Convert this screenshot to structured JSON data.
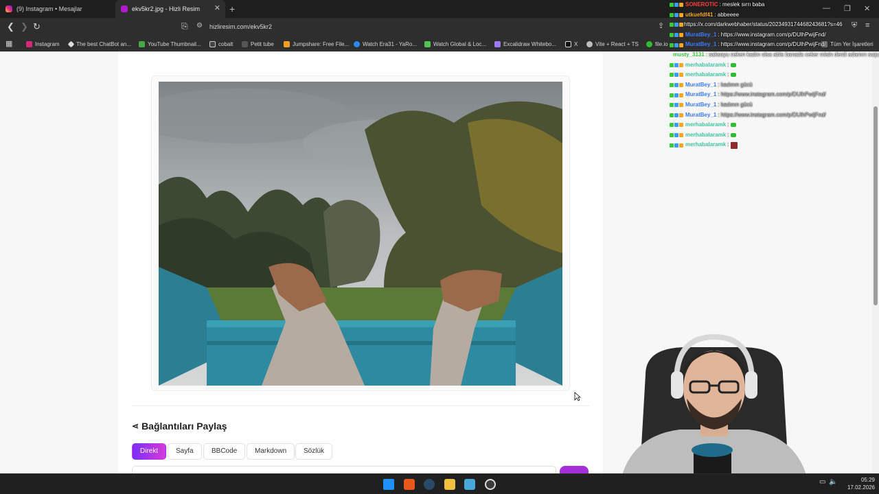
{
  "browser": {
    "tabs": [
      {
        "label": "(9) Instagram • Mesajlar",
        "active": false
      },
      {
        "label": "ekv5kr2.jpg - Hizli Resim",
        "active": true
      }
    ],
    "url": "hizliresim.com/ekv5kr2",
    "bookmarks": [
      {
        "label": "Instagram",
        "color": "#d62976"
      },
      {
        "label": "The best ChatBot an...",
        "color": "#dddddd"
      },
      {
        "label": "YouTube Thumbnail...",
        "color": "#44aa44"
      },
      {
        "label": "cobalt",
        "color": "#cfcfcf"
      },
      {
        "label": "Petit tube",
        "color": "#cfcfcf"
      },
      {
        "label": "Jumpshare: Free File...",
        "color": "#f0a020"
      },
      {
        "label": "Watch Era31 - YaRo...",
        "color": "#2a8cf0"
      },
      {
        "label": "Watch Global & Loc...",
        "color": "#53c453"
      },
      {
        "label": "Excalidraw Whitebo...",
        "color": "#9b7bf0"
      },
      {
        "label": "X",
        "color": "#ffffff"
      },
      {
        "label": "Vite + React + TS",
        "color": "#bdbdbd"
      },
      {
        "label": "file.io",
        "color": "#33bb33"
      }
    ],
    "other_bookmarks": "Tüm Yer İşaretleri"
  },
  "share": {
    "title": "Bağlantıları Paylaş",
    "tabs": [
      "Direkt",
      "Sayfa",
      "BBCode",
      "Markdown",
      "Sözlük"
    ],
    "active_tab": "Direkt"
  },
  "chat": [
    {
      "user": "SONEROTIC",
      "user_color": "#ff3b3b",
      "msg": ": meslek sırrı baba",
      "dim": false
    },
    {
      "user": "utkuefdf41",
      "user_color": "#f5a623",
      "msg": ": abbeeee",
      "dim": false
    },
    {
      "user": "",
      "user_color": "#ffffff",
      "msg": "https://x.com/darkwebhaber/status/2023493174468243681?s=46",
      "dim": false
    },
    {
      "user": "MuratBey_1",
      "user_color": "#3b7bff",
      "msg": ": https://www.instagram.com/p/DUlhPwijFnd/",
      "dim": false
    },
    {
      "user": "MuratBey_1",
      "user_color": "#3b7bff",
      "msg": ": https://www.instagram.com/p/DUlhPwijFnd/",
      "dim": false
    },
    {
      "user": "musty_3131",
      "user_color": "#3cc43c",
      "msg": ": saksoyu ceken kadın olsa abla banada ceker misin derdi adamın suçu ne",
      "dim": false
    },
    {
      "user": "merhabalaramk",
      "user_color": "#3cc4a0",
      "msg": ":",
      "dim": true,
      "emote": true
    },
    {
      "user": "merhabalaramk",
      "user_color": "#3cc4a0",
      "msg": ":",
      "dim": true,
      "emote": true
    },
    {
      "user": "MuratBey_1",
      "user_color": "#3b7bff",
      "msg": ": kadının gücü",
      "dim": true
    },
    {
      "user": "MuratBey_1",
      "user_color": "#3b7bff",
      "msg": ": https://www.instagram.com/p/DUlhPwijFnd/",
      "dim": true
    },
    {
      "user": "MuratBey_1",
      "user_color": "#3b7bff",
      "msg": ": kadının gücü",
      "dim": true
    },
    {
      "user": "MuratBey_1",
      "user_color": "#3b7bff",
      "msg": ": https://www.instagram.com/p/DUlhPwijFnd/",
      "dim": true
    },
    {
      "user": "merhabalaramk",
      "user_color": "#3cc4a0",
      "msg": ":",
      "dim": true,
      "emote": true
    },
    {
      "user": "merhabalaramk",
      "user_color": "#3cc4a0",
      "msg": ":",
      "dim": true,
      "emote": true
    },
    {
      "user": "merhabalaramk",
      "user_color": "#3cc4a0",
      "msg": ":",
      "dim": true,
      "emote_img": true
    }
  ],
  "clock": {
    "time": "05:29",
    "date": "17.02.2026"
  }
}
